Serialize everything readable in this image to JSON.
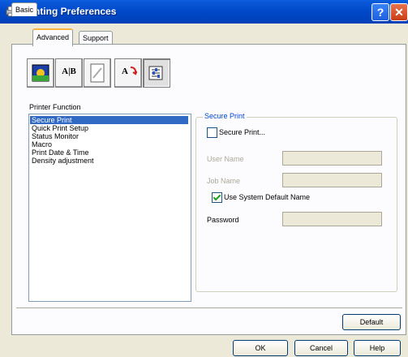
{
  "window": {
    "title": "Printing Preferences"
  },
  "tabs": [
    {
      "label": "Basic"
    },
    {
      "label": "Advanced",
      "active": true
    },
    {
      "label": "Support"
    }
  ],
  "feature_buttons": [
    {
      "icon": "print-quality-icon"
    },
    {
      "icon": "duplex-icon",
      "text": "A|B"
    },
    {
      "icon": "watermark-icon"
    },
    {
      "icon": "page-setting-icon",
      "text": "A"
    },
    {
      "icon": "device-options-icon",
      "selected": true
    }
  ],
  "printer_function": {
    "label": "Printer Function",
    "items": [
      {
        "label": "Secure Print",
        "selected": true
      },
      {
        "label": "Quick Print Setup"
      },
      {
        "label": "Status Monitor"
      },
      {
        "label": "Macro"
      },
      {
        "label": "Print Date & Time"
      },
      {
        "label": "Density adjustment"
      }
    ]
  },
  "secure_print": {
    "title": "Secure Print",
    "checkbox_label": "Secure Print...",
    "checked": false,
    "user_name_label": "User Name",
    "job_name_label": "Job Name",
    "use_default_label": "Use System Default Name",
    "use_default_checked": true,
    "password_label": "Password"
  },
  "buttons": {
    "default": "Default",
    "ok": "OK",
    "cancel": "Cancel",
    "help": "Help"
  },
  "colors": {
    "titlebar": "#0048c8",
    "selection": "#316ac5",
    "group_title": "#0046d5",
    "tab_highlight": "#f8b33c"
  }
}
